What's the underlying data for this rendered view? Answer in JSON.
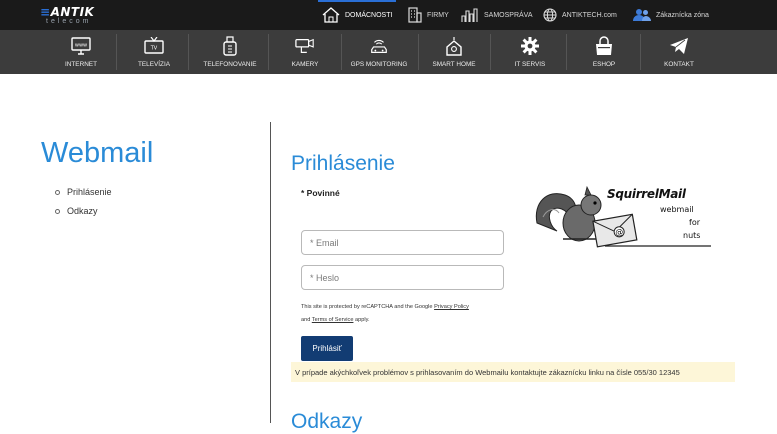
{
  "brand": {
    "name": "ANTIK",
    "sub": "telecom"
  },
  "topbar": [
    {
      "label": "DOMÁCNOSTI",
      "icon": "house-icon",
      "active": true
    },
    {
      "label": "FIRMY",
      "icon": "building-icon",
      "active": false
    },
    {
      "label": "SAMOSPRÁVA",
      "icon": "city-icon",
      "active": false
    },
    {
      "label": "ANTIKTECH.com",
      "icon": "globe-icon",
      "active": false
    },
    {
      "label": "Zákaznícka zóna",
      "icon": "users-icon",
      "active": false
    }
  ],
  "nav": [
    {
      "label": "INTERNET",
      "icon": "www-monitor-icon"
    },
    {
      "label": "TELEVÍZIA",
      "icon": "tv-icon"
    },
    {
      "label": "TELEFONOVANIE",
      "icon": "phone-icon"
    },
    {
      "label": "KAMERY",
      "icon": "camera-icon"
    },
    {
      "label": "GPS MONITORING",
      "icon": "car-gps-icon"
    },
    {
      "label": "SMART HOME",
      "icon": "smart-home-icon"
    },
    {
      "label": "IT SERVIS",
      "icon": "gear-icon"
    },
    {
      "label": "ESHOP",
      "icon": "shopping-bag-icon"
    },
    {
      "label": "KONTAKT",
      "icon": "paper-plane-icon"
    }
  ],
  "sidebar": {
    "title": "Webmail",
    "links": [
      "Prihlásenie",
      "Odkazy"
    ]
  },
  "login": {
    "title": "Prihlásenie",
    "required": "* Povinné",
    "email_placeholder": "* Email",
    "password_placeholder": "* Heslo",
    "captcha_prefix": "This site is protected by reCAPTCHA and the Google ",
    "privacy_link": "Privacy Policy",
    "captcha_and": "and ",
    "terms_link": "Terms of Service",
    "captcha_suffix": " apply.",
    "button": "Prihlásiť",
    "notice": "V prípade akýchkoľvek problémov s prihlasovaním do Webmailu kontaktujte zákaznícku linku na čísle 055/30 12345"
  },
  "squirrelmail": {
    "title": "SquirrelMail",
    "line1": "webmail",
    "line2": "for",
    "line3": "nuts"
  },
  "next_section": {
    "title": "Odkazy"
  }
}
